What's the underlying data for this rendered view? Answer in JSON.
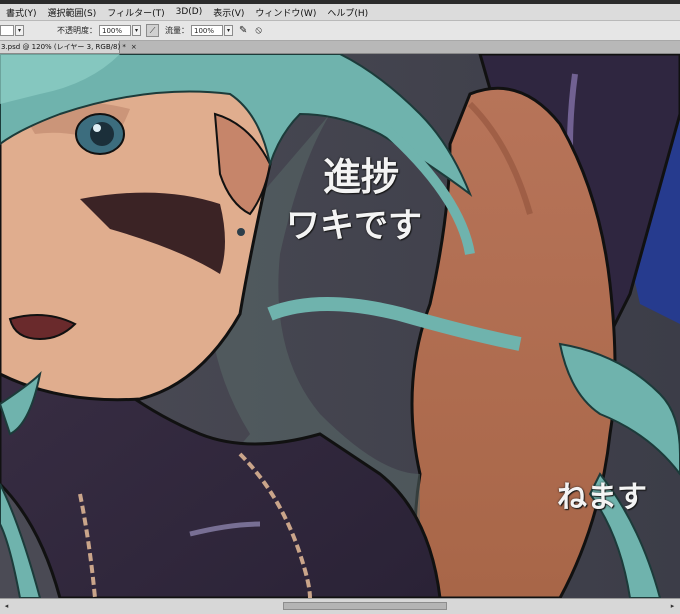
{
  "menu": [
    {
      "label": "書式(Y)"
    },
    {
      "label": "選択範囲(S)"
    },
    {
      "label": "フィルター(T)"
    },
    {
      "label": "3D(D)"
    },
    {
      "label": "表示(V)"
    },
    {
      "label": "ウィンドウ(W)"
    },
    {
      "label": "ヘルプ(H)"
    }
  ],
  "options": {
    "opacity_label": "不透明度：",
    "opacity_value": "100%",
    "flow_label": "流量：",
    "flow_value": "100%"
  },
  "document": {
    "tab_label": "3.psd @ 120% (レイヤー 3, RGB/8) *",
    "close_glyph": "×"
  },
  "canvas_text": {
    "line1": "進捗",
    "line2": "ワキです",
    "line3": "ねます"
  },
  "icons": {
    "airbrush": "airbrush-icon",
    "tablet_pressure": "tablet-pressure-icon",
    "scroll_left": "◂",
    "scroll_right": "▸"
  },
  "colors": {
    "workspace": "#535353",
    "menubar": "#dcdcdc",
    "optionsbar": "#e6e6e6",
    "tabbar": "#b8b8b8"
  }
}
